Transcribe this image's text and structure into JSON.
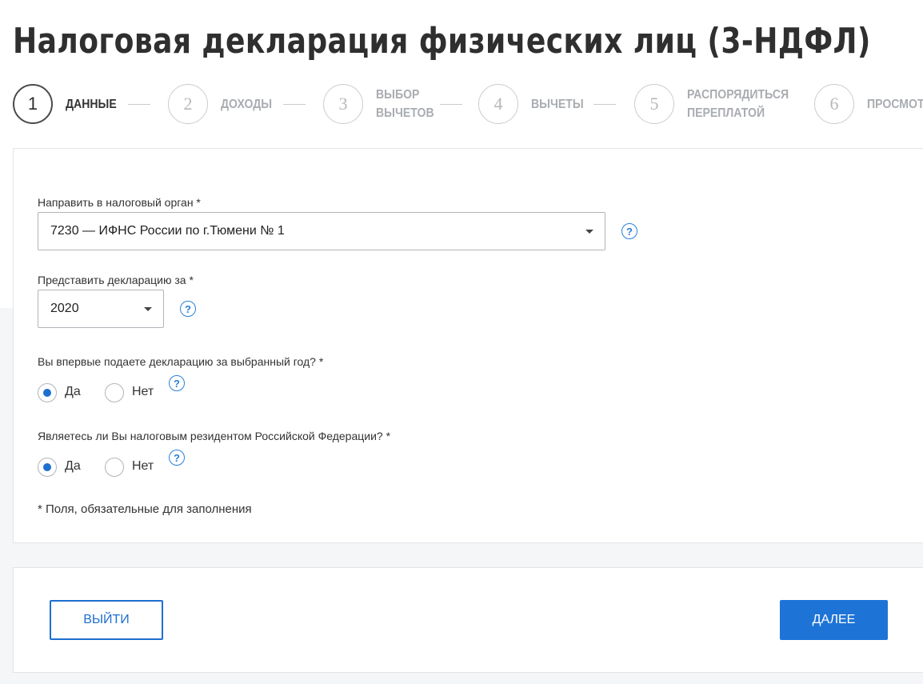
{
  "page": {
    "title": "Налоговая декларация физических лиц (3-НДФЛ)"
  },
  "steps": [
    {
      "number": "1",
      "label_line1": "ДАННЫЕ",
      "label_line2": "",
      "active": true
    },
    {
      "number": "2",
      "label_line1": "ДОХОДЫ",
      "label_line2": "",
      "active": false
    },
    {
      "number": "3",
      "label_line1": "ВЫБОР",
      "label_line2": "ВЫЧЕТОВ",
      "active": false
    },
    {
      "number": "4",
      "label_line1": "ВЫЧЕТЫ",
      "label_line2": "",
      "active": false
    },
    {
      "number": "5",
      "label_line1": "РАСПОРЯДИТЬСЯ",
      "label_line2": "ПЕРЕПЛАТОЙ",
      "active": false
    },
    {
      "number": "6",
      "label_line1": "ПРОСМОТР",
      "label_line2": "",
      "active": false
    }
  ],
  "form": {
    "tax_authority": {
      "label": "Направить в налоговый орган *",
      "value": "7230 — ИФНС России по г.Тюмени № 1"
    },
    "year": {
      "label": "Представить декларацию за *",
      "value": "2020"
    },
    "first_time": {
      "question": "Вы впервые подаете декларацию за выбранный год? *",
      "yes_label": "Да",
      "no_label": "Нет",
      "selected": "Да"
    },
    "resident": {
      "question": "Являетесь ли Вы налоговым резидентом Российской Федерации? *",
      "yes_label": "Да",
      "no_label": "Нет",
      "selected": "Да"
    },
    "help_glyph": "?",
    "footnote": "* Поля, обязательные для заполнения"
  },
  "actions": {
    "exit_label": "ВЫЙТИ",
    "next_label": "ДАЛЕЕ"
  },
  "colors": {
    "accent": "#1e73d6",
    "step_inactive": "#a9acb0",
    "background_lower": "#f4f6f8"
  },
  "icons": {
    "help": "question-circle-icon",
    "dropdown": "caret-down-icon"
  }
}
